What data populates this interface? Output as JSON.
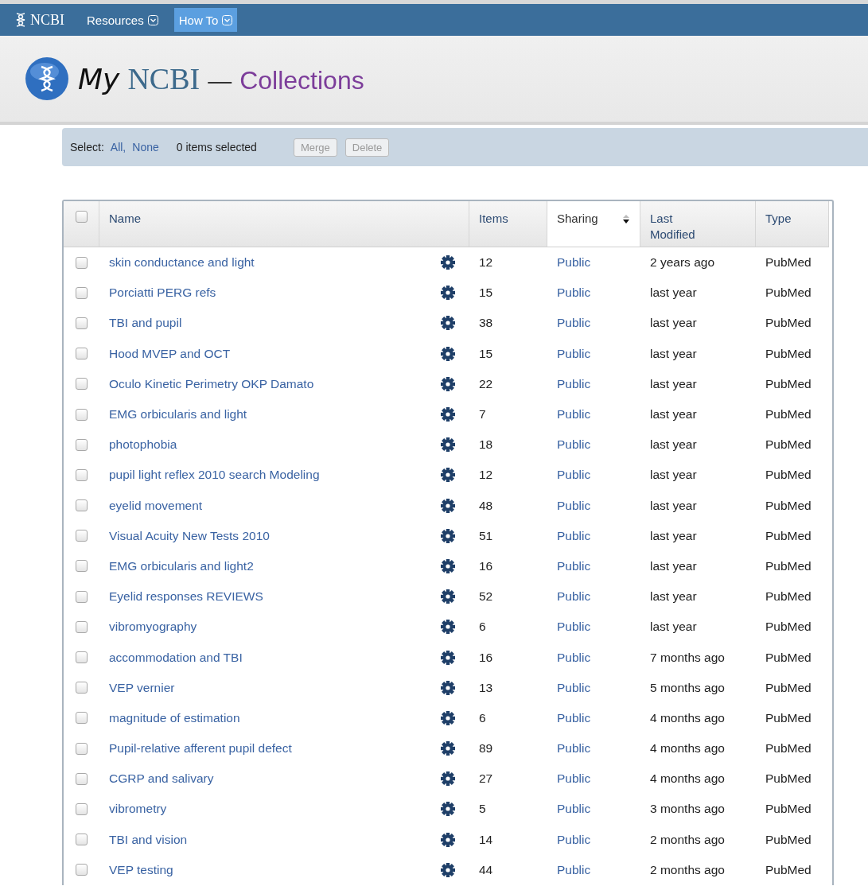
{
  "top_bar": {
    "logo": "NCBI",
    "menus": [
      {
        "label": "Resources",
        "selected": false
      },
      {
        "label": "How To",
        "selected": true
      }
    ]
  },
  "header": {
    "title_my": "My",
    "title_ncbi": "NCBI",
    "title_dash": "—",
    "title_section": "Collections"
  },
  "select_bar": {
    "label": "Select:",
    "links": [
      "All,",
      "None"
    ],
    "count": "0 items selected",
    "buttons": [
      {
        "label": "Merge",
        "disabled": true
      },
      {
        "label": "Delete",
        "disabled": true
      }
    ]
  },
  "table": {
    "select_all_checked": false,
    "columns": [
      {
        "label": "Name",
        "sorted": false
      },
      {
        "label": "Items",
        "sorted": false
      },
      {
        "label": "Sharing",
        "sorted": true
      },
      {
        "label": "Last Modified",
        "sorted": false
      },
      {
        "label": "Type",
        "sorted": false
      }
    ],
    "rows": [
      {
        "checked": false,
        "name": "skin conductance and light",
        "items": "12",
        "sharing": "Public",
        "modified": "2 years ago",
        "type": "PubMed"
      },
      {
        "checked": false,
        "name": "Porciatti PERG refs",
        "items": "15",
        "sharing": "Public",
        "modified": "last year",
        "type": "PubMed"
      },
      {
        "checked": false,
        "name": "TBI and pupil",
        "items": "38",
        "sharing": "Public",
        "modified": "last year",
        "type": "PubMed"
      },
      {
        "checked": false,
        "name": "Hood MVEP and OCT",
        "items": "15",
        "sharing": "Public",
        "modified": "last year",
        "type": "PubMed"
      },
      {
        "checked": false,
        "name": "Oculo Kinetic Perimetry OKP Damato",
        "items": "22",
        "sharing": "Public",
        "modified": "last year",
        "type": "PubMed"
      },
      {
        "checked": false,
        "name": "EMG orbicularis and light",
        "items": "7",
        "sharing": "Public",
        "modified": "last year",
        "type": "PubMed"
      },
      {
        "checked": false,
        "name": "photophobia",
        "items": "18",
        "sharing": "Public",
        "modified": "last year",
        "type": "PubMed"
      },
      {
        "checked": false,
        "name": "pupil light reflex 2010 search Modeling",
        "items": "12",
        "sharing": "Public",
        "modified": "last year",
        "type": "PubMed"
      },
      {
        "checked": false,
        "name": "eyelid movement",
        "items": "48",
        "sharing": "Public",
        "modified": "last year",
        "type": "PubMed"
      },
      {
        "checked": false,
        "name": "Visual Acuity New Tests 2010",
        "items": "51",
        "sharing": "Public",
        "modified": "last year",
        "type": "PubMed"
      },
      {
        "checked": false,
        "name": "EMG orbicularis and light2",
        "items": "16",
        "sharing": "Public",
        "modified": "last year",
        "type": "PubMed"
      },
      {
        "checked": false,
        "name": "Eyelid responses REVIEWS",
        "items": "52",
        "sharing": "Public",
        "modified": "last year",
        "type": "PubMed"
      },
      {
        "checked": false,
        "name": "vibromyography",
        "items": "6",
        "sharing": "Public",
        "modified": "last year",
        "type": "PubMed"
      },
      {
        "checked": false,
        "name": "accommodation and TBI",
        "items": "16",
        "sharing": "Public",
        "modified": "7 months ago",
        "type": "PubMed"
      },
      {
        "checked": false,
        "name": "VEP vernier",
        "items": "13",
        "sharing": "Public",
        "modified": "5 months ago",
        "type": "PubMed"
      },
      {
        "checked": false,
        "name": "magnitude of estimation",
        "items": "6",
        "sharing": "Public",
        "modified": "4 months ago",
        "type": "PubMed"
      },
      {
        "checked": false,
        "name": "Pupil-relative afferent pupil defect",
        "items": "89",
        "sharing": "Public",
        "modified": "4 months ago",
        "type": "PubMed"
      },
      {
        "checked": false,
        "name": "CGRP and salivary",
        "items": "27",
        "sharing": "Public",
        "modified": "4 months ago",
        "type": "PubMed"
      },
      {
        "checked": false,
        "name": "vibrometry",
        "items": "5",
        "sharing": "Public",
        "modified": "3 months ago",
        "type": "PubMed"
      },
      {
        "checked": false,
        "name": "TBI and vision",
        "items": "14",
        "sharing": "Public",
        "modified": "2 months ago",
        "type": "PubMed"
      },
      {
        "checked": false,
        "name": "VEP testing",
        "items": "44",
        "sharing": "Public",
        "modified": "2 months ago",
        "type": "PubMed"
      }
    ]
  }
}
